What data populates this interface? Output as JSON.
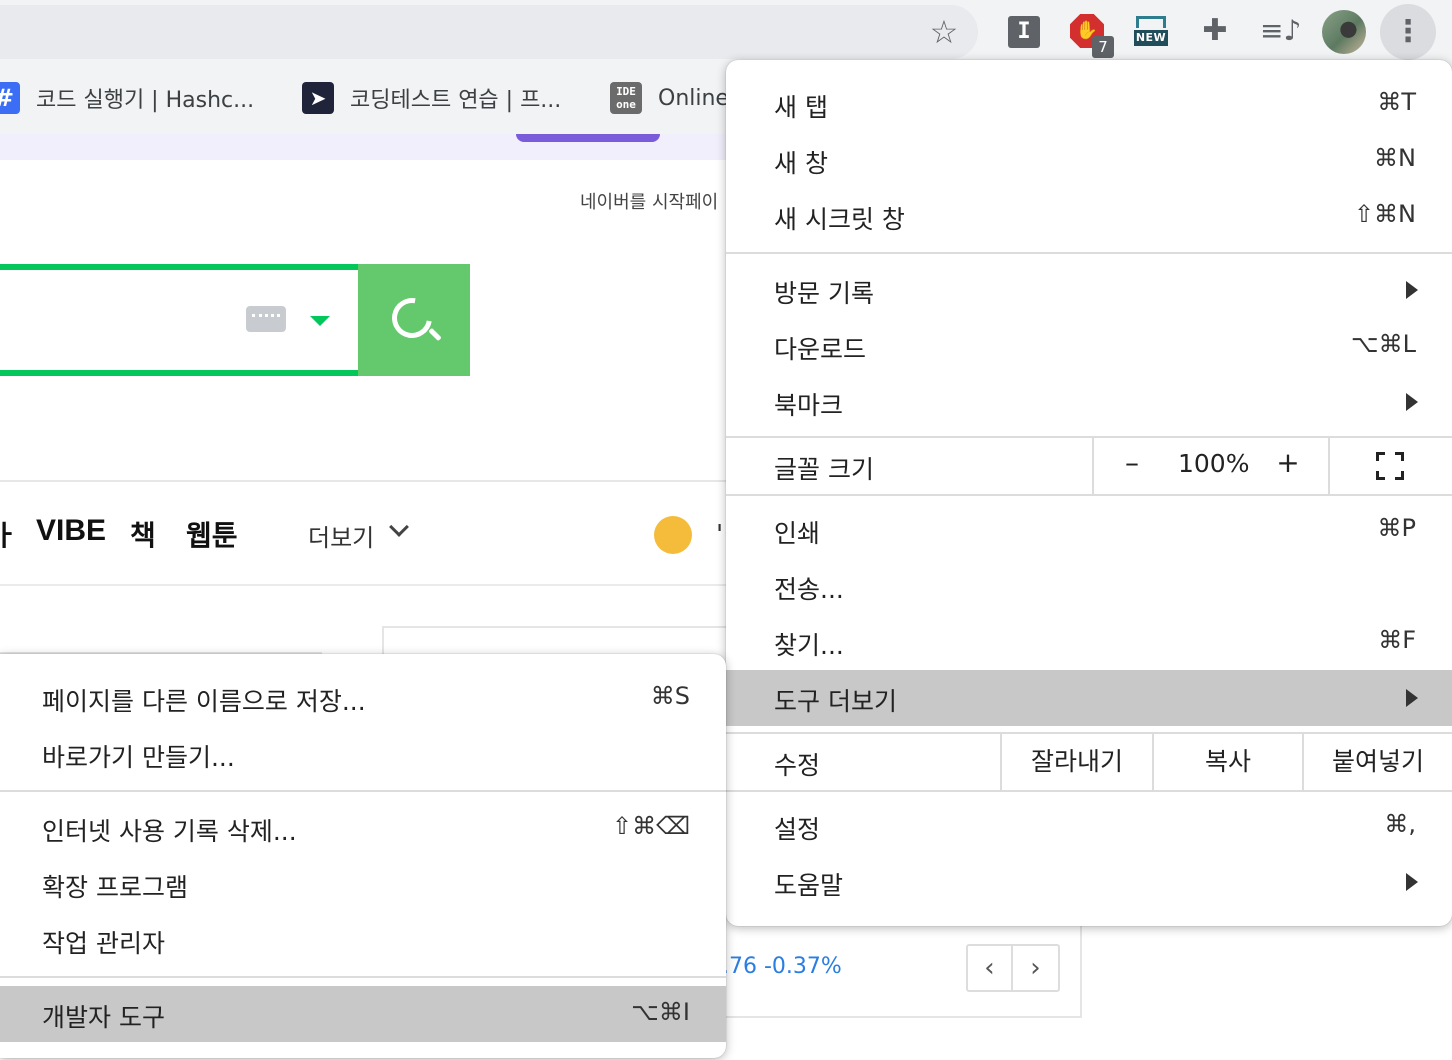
{
  "browser": {
    "extension_badge_count": "7",
    "extension_new_label": "NEW",
    "bookmarks": [
      {
        "label": "코드 실행기 | Hashc..."
      },
      {
        "label": "코딩테스트 연습 | 프..."
      },
      {
        "label": "Online"
      }
    ]
  },
  "page": {
    "start_page_text": "네이버를 시작페이",
    "nav": {
      "cut_item": "ㅏ",
      "vibe": "VIBE",
      "book": "책",
      "webtoon": "웹툰",
      "more": "더보기"
    },
    "stock_text": ".76 -0.37%"
  },
  "main_menu": {
    "new_tab": {
      "label": "새 탭",
      "shortcut": "⌘T"
    },
    "new_window": {
      "label": "새 창",
      "shortcut": "⌘N"
    },
    "incognito": {
      "label": "새 시크릿 창",
      "shortcut": "⇧⌘N"
    },
    "history": {
      "label": "방문 기록"
    },
    "downloads": {
      "label": "다운로드",
      "shortcut": "⌥⌘L"
    },
    "bookmarks": {
      "label": "북마크"
    },
    "zoom": {
      "label": "글꼴 크기",
      "minus": "–",
      "value": "100%",
      "plus": "+"
    },
    "print": {
      "label": "인쇄",
      "shortcut": "⌘P"
    },
    "cast": {
      "label": "전송..."
    },
    "find": {
      "label": "찾기...",
      "shortcut": "⌘F"
    },
    "more_tools": {
      "label": "도구 더보기"
    },
    "edit": {
      "label": "수정",
      "cut": "잘라내기",
      "copy": "복사",
      "paste": "붙여넣기"
    },
    "settings": {
      "label": "설정",
      "shortcut": "⌘,"
    },
    "help": {
      "label": "도움말"
    }
  },
  "sub_menu": {
    "save_page": {
      "label": "페이지를 다른 이름으로 저장...",
      "shortcut": "⌘S"
    },
    "create_shortcut": {
      "label": "바로가기 만들기..."
    },
    "clear_data": {
      "label": "인터넷 사용 기록 삭제...",
      "shortcut": "⇧⌘⌫"
    },
    "extensions": {
      "label": "확장 프로그램"
    },
    "task_manager": {
      "label": "작업 관리자"
    },
    "dev_tools": {
      "label": "개발자 도구",
      "shortcut": "⌥⌘I"
    }
  },
  "colors": {
    "naver_green": "#03c75a",
    "highlight": "#c8c8c8",
    "stock_blue": "#2a7de1"
  }
}
